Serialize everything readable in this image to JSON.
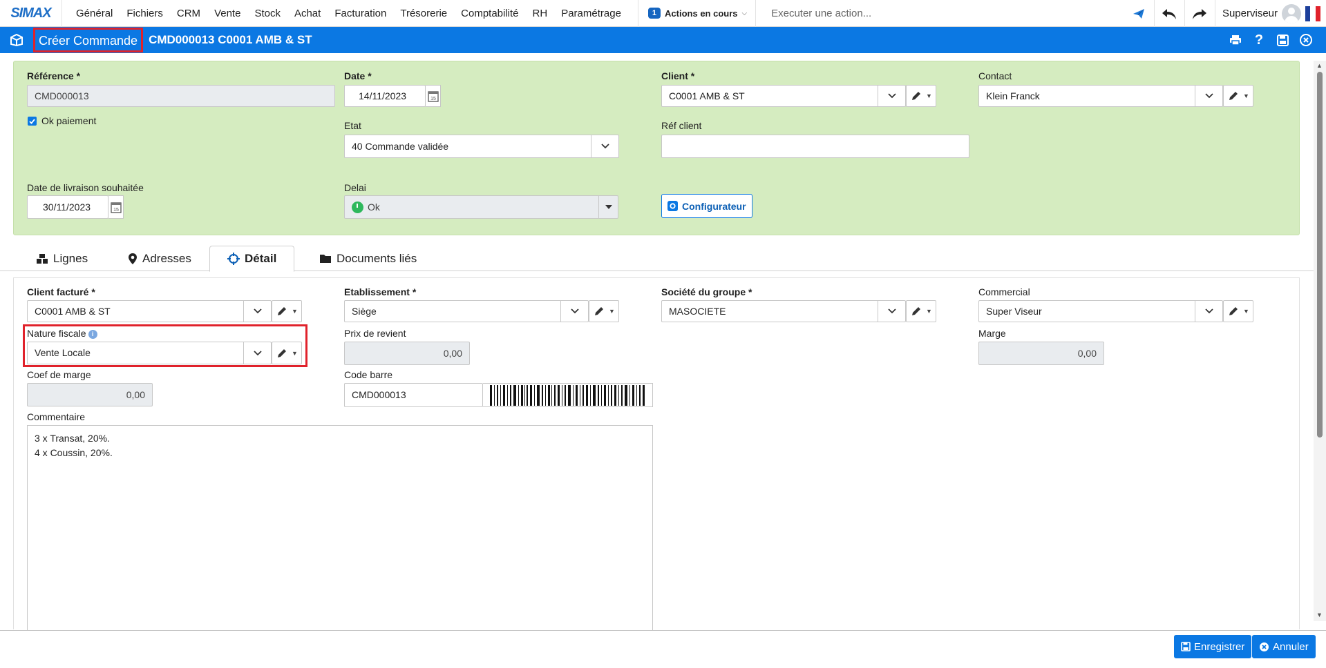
{
  "app": {
    "logo": "SIMAX",
    "menu": [
      "Général",
      "Fichiers",
      "CRM",
      "Vente",
      "Stock",
      "Achat",
      "Facturation",
      "Trésorerie",
      "Comptabilité",
      "RH",
      "Paramétrage"
    ],
    "actions_count": "1",
    "actions_label": "Actions en cours",
    "command_placeholder": "Executer une action...",
    "user_name": "Superviseur",
    "accent_color": "#0b78e3",
    "highlight_color": "#e0222b"
  },
  "titlebar": {
    "page_title": "Créer Commande",
    "document": "CMD000013 C0001 AMB & ST",
    "tools": [
      "print-icon",
      "help-icon",
      "save-icon",
      "close-icon"
    ]
  },
  "header_form": {
    "reference_label": "Référence *",
    "reference_value": "CMD000013",
    "date_label": "Date *",
    "date_value": "14/11/2023",
    "client_label": "Client *",
    "client_value": "C0001 AMB & ST",
    "contact_label": "Contact",
    "contact_value": "Klein Franck",
    "ok_paiement_label": "Ok paiement",
    "ok_paiement_checked": true,
    "etat_label": "Etat",
    "etat_value": "40 Commande validée",
    "ref_client_label": "Réf client",
    "ref_client_value": "",
    "date_livraison_label": "Date de livraison souhaitée",
    "date_livraison_value": "30/11/2023",
    "delai_label": "Delai",
    "delai_value": "Ok",
    "configurateur_label": "Configurateur"
  },
  "tabs": [
    {
      "label": "Lignes",
      "icon": "boxes-icon"
    },
    {
      "label": "Adresses",
      "icon": "map-marker-icon"
    },
    {
      "label": "Détail",
      "icon": "crosshair-icon",
      "active": true
    },
    {
      "label": "Documents liés",
      "icon": "folder-icon"
    }
  ],
  "detail": {
    "client_facture_label": "Client facturé *",
    "client_facture_value": "C0001 AMB & ST",
    "etablissement_label": "Etablissement *",
    "etablissement_value": "Siège",
    "societe_label": "Société du groupe *",
    "societe_value": "MASOCIETE",
    "commercial_label": "Commercial",
    "commercial_value": "Super Viseur",
    "nature_fiscale_label": "Nature fiscale",
    "nature_fiscale_value": "Vente Locale",
    "prix_revient_label": "Prix de revient",
    "prix_revient_value": "0,00",
    "marge_label": "Marge",
    "marge_value": "0,00",
    "coef_marge_label": "Coef de marge",
    "coef_marge_value": "0,00",
    "code_barre_label": "Code barre",
    "code_barre_value": "CMD000013",
    "commentaire_label": "Commentaire",
    "commentaire_lines": [
      "3 x Transat, 20%.",
      "4 x Coussin, 20%."
    ]
  },
  "footer": {
    "save_label": "Enregistrer",
    "cancel_label": "Annuler"
  }
}
